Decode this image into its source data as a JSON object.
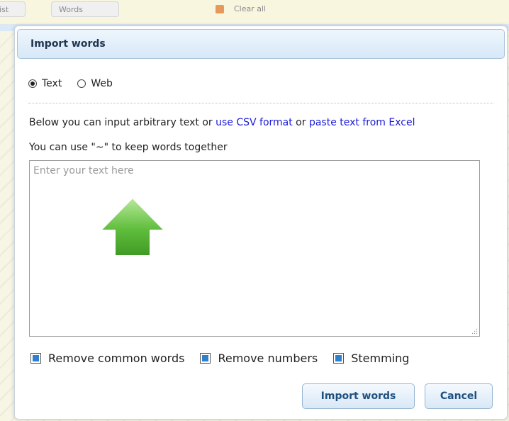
{
  "background": {
    "tabs": [
      "List",
      "Words",
      "Clear all"
    ]
  },
  "dialog": {
    "title": "Import words",
    "source_options": [
      {
        "label": "Text",
        "checked": true
      },
      {
        "label": "Web",
        "checked": false
      }
    ],
    "info": {
      "prefix": "Below you can input arbitrary text or ",
      "csv_link": "use CSV format",
      "middle": " or ",
      "excel_link": "paste text from Excel",
      "line2": "You can use \"~\" to keep words together"
    },
    "textarea": {
      "placeholder": "Enter your text here",
      "value": ""
    },
    "hint_icon": "green-up-arrow-icon",
    "options": [
      {
        "label": "Remove common words",
        "checked": true
      },
      {
        "label": "Remove numbers",
        "checked": true
      },
      {
        "label": "Stemming",
        "checked": true
      }
    ],
    "buttons": {
      "import": "Import words",
      "cancel": "Cancel"
    }
  },
  "colors": {
    "header_bg": "#d7e8f7",
    "link": "#1a1ad8",
    "checkbox_fill": "#2f7fcf",
    "arrow_green": "#5cb83a"
  }
}
